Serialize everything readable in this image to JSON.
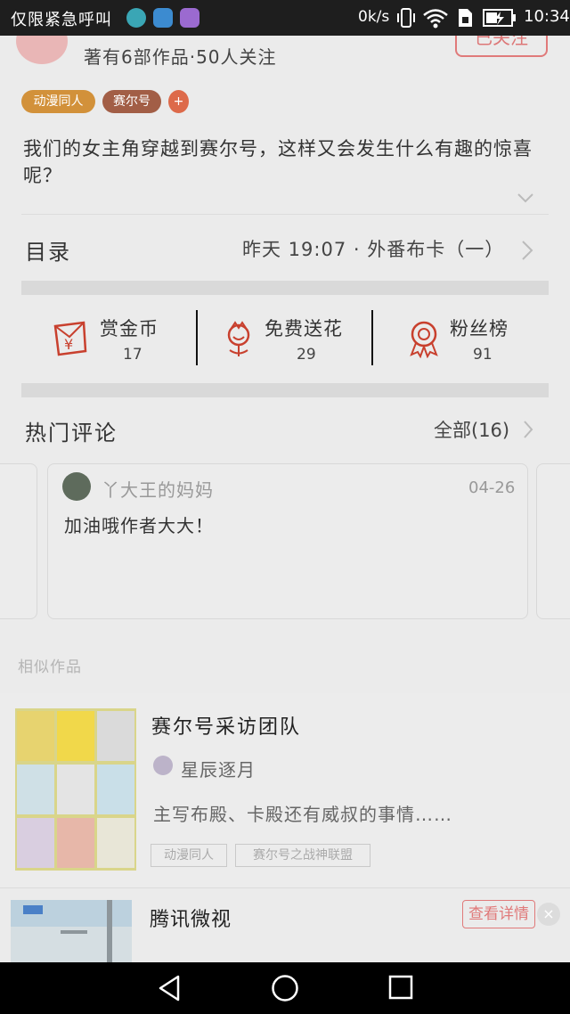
{
  "status_bar": {
    "carrier": "仅限紧急呼叫",
    "speed": "0k/s",
    "time": "10:34"
  },
  "author": {
    "stats": "著有6部作品·50人关注",
    "follow_label": "已关注"
  },
  "tags": [
    "动漫同人",
    "赛尔号",
    "+"
  ],
  "description": "我们的女主角穿越到赛尔号，这样又会发生什么有趣的惊喜呢？",
  "toc": {
    "title": "目录",
    "latest": "昨天 19:07 · 外番布卡（一）"
  },
  "stats": [
    {
      "label": "赏金币",
      "value": "17"
    },
    {
      "label": "免费送花",
      "value": "29"
    },
    {
      "label": "粉丝榜",
      "value": "91"
    }
  ],
  "comments": {
    "title": "热门评论",
    "all_label": "全部(16)",
    "items": [
      {
        "user": "丫大王的妈妈",
        "date": "04-26",
        "text": "加油哦作者大大！"
      }
    ]
  },
  "similar": {
    "label": "相似作品",
    "work": {
      "title": "赛尔号采访团队",
      "author": "星辰逐月",
      "desc": "主写布殿、卡殿还有威叔的事情……",
      "tags": [
        "动漫同人",
        "赛尔号之战神联盟"
      ]
    }
  },
  "ad": {
    "title": "腾讯微视",
    "button": "查看详情",
    "close": "×"
  },
  "colors": {
    "accent": "#e07a7a",
    "tag_orange": "#d2913a",
    "tag_brown": "#a25e46",
    "tag_red": "#dd6a4a"
  },
  "icons": {
    "status": [
      "moon-app-icon",
      "compass-app-icon",
      "gallery-app-icon",
      "vibrate-icon",
      "wifi-icon",
      "sim-icon",
      "battery-icon"
    ],
    "stats": [
      "red-envelope-icon",
      "flower-icon",
      "medal-icon"
    ],
    "nav": [
      "back-icon",
      "home-icon",
      "recents-icon"
    ]
  }
}
